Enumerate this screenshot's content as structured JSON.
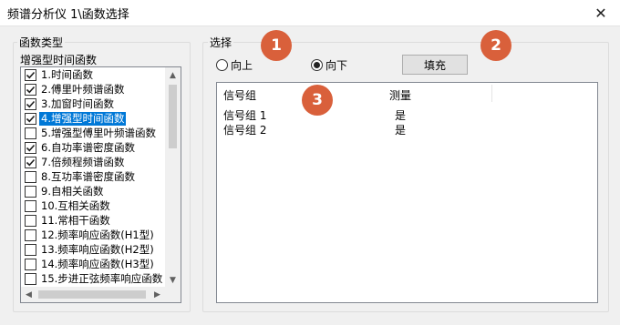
{
  "window": {
    "title": "频谱分析仪 1\\函数选择"
  },
  "function_type": {
    "group_label": "函数类型",
    "sublabel": "增强型时间函数",
    "items": [
      {
        "label": "1.时间函数",
        "checked": true,
        "selected": false
      },
      {
        "label": "2.傅里叶频谱函数",
        "checked": true,
        "selected": false
      },
      {
        "label": "3.加窗时间函数",
        "checked": true,
        "selected": false
      },
      {
        "label": "4.增强型时间函数",
        "checked": true,
        "selected": true
      },
      {
        "label": "5.增强型傅里叶频谱函数",
        "checked": false,
        "selected": false
      },
      {
        "label": "6.自功率谱密度函数",
        "checked": true,
        "selected": false
      },
      {
        "label": "7.倍频程频谱函数",
        "checked": true,
        "selected": false
      },
      {
        "label": "8.互功率谱密度函数",
        "checked": false,
        "selected": false
      },
      {
        "label": "9.自相关函数",
        "checked": false,
        "selected": false
      },
      {
        "label": "10.互相关函数",
        "checked": false,
        "selected": false
      },
      {
        "label": "11.常相干函数",
        "checked": false,
        "selected": false
      },
      {
        "label": "12.频率响应函数(H1型)",
        "checked": false,
        "selected": false
      },
      {
        "label": "13.频率响应函数(H2型)",
        "checked": false,
        "selected": false
      },
      {
        "label": "14.频率响应函数(H3型)",
        "checked": false,
        "selected": false
      },
      {
        "label": "15.步进正弦频率响应函数",
        "checked": false,
        "selected": false
      }
    ]
  },
  "selection": {
    "group_label": "选择",
    "radio_up": {
      "label": "向上",
      "checked": false
    },
    "radio_down": {
      "label": "向下",
      "checked": true
    },
    "fill_button": "填充",
    "table": {
      "columns": [
        "信号组",
        "测量"
      ],
      "rows": [
        {
          "signal": "信号组 1",
          "measure": "是"
        },
        {
          "signal": "信号组 2",
          "measure": "是"
        }
      ]
    }
  },
  "annotations": {
    "color": "#d9603b",
    "badges": [
      "1",
      "2",
      "3"
    ]
  }
}
